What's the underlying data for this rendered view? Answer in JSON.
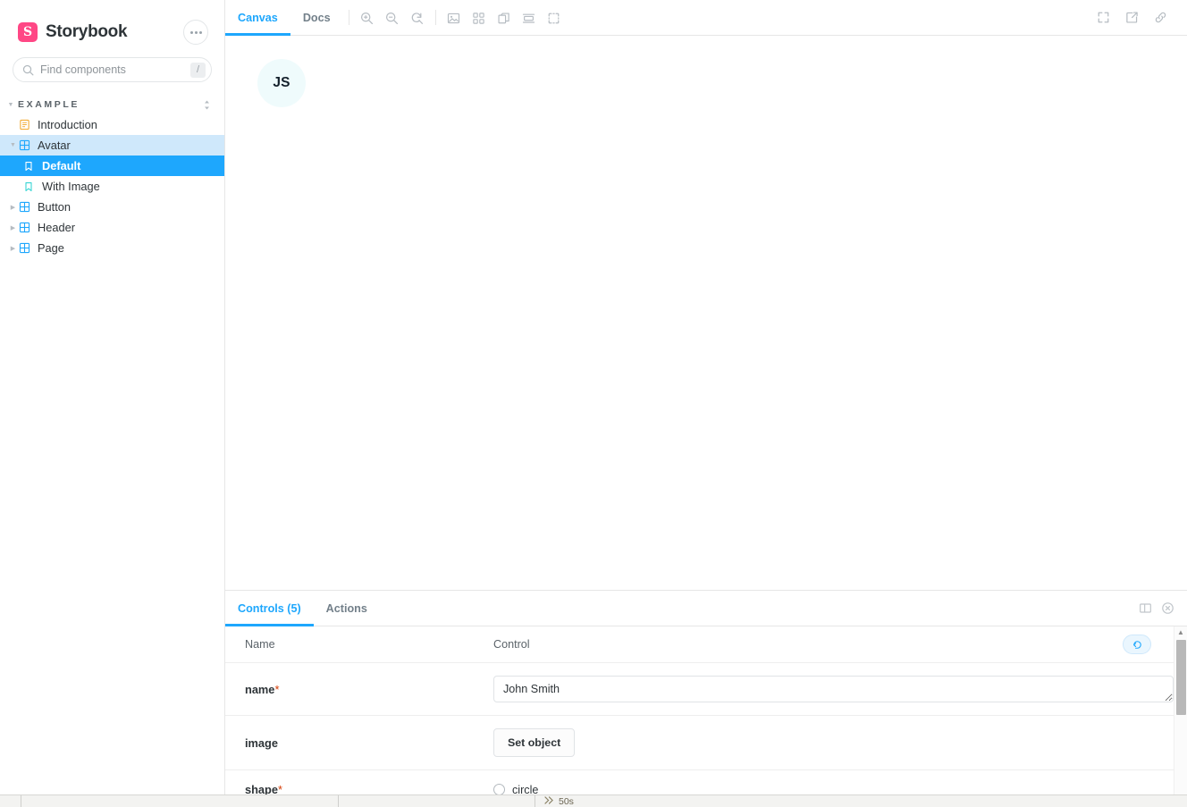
{
  "brand": {
    "name": "Storybook",
    "logo_letter": "S",
    "logo_color": "#ff4785",
    "menu_icon": "ellipsis-icon"
  },
  "search": {
    "placeholder": "Find components",
    "value": "",
    "shortcut": "/"
  },
  "sidebar": {
    "section": {
      "label": "EXAMPLE"
    },
    "items": [
      {
        "label": "Introduction",
        "icon": "document-icon",
        "level": 1,
        "state": "normal"
      },
      {
        "label": "Avatar",
        "icon": "component-icon",
        "level": 1,
        "state": "parent-active"
      },
      {
        "label": "Default",
        "icon": "story-icon",
        "level": 2,
        "state": "selected"
      },
      {
        "label": "With Image",
        "icon": "story-icon",
        "level": 2,
        "state": "normal"
      },
      {
        "label": "Button",
        "icon": "component-icon",
        "level": 1,
        "state": "normal"
      },
      {
        "label": "Header",
        "icon": "component-icon",
        "level": 1,
        "state": "normal"
      },
      {
        "label": "Page",
        "icon": "component-icon",
        "level": 1,
        "state": "normal"
      }
    ]
  },
  "toolbar": {
    "tabs": [
      {
        "label": "Canvas",
        "active": true
      },
      {
        "label": "Docs",
        "active": false
      }
    ],
    "zoom_tools": [
      "zoom-in-icon",
      "zoom-out-icon",
      "zoom-reset-icon"
    ],
    "view_tools": [
      "backgrounds-icon",
      "grid-icon",
      "measure-icon",
      "viewport-icon",
      "outline-icon"
    ],
    "right_tools": [
      "fullscreen-icon",
      "open-new-tab-icon",
      "copy-link-icon"
    ]
  },
  "canvas": {
    "avatar": {
      "initials": "JS",
      "background": "#effbfc",
      "text_color": "#13202b"
    }
  },
  "panel": {
    "tabs": [
      {
        "label": "Controls (5)",
        "active": true
      },
      {
        "label": "Actions",
        "active": false
      }
    ],
    "icons": [
      "panel-layout-icon",
      "close-panel-icon"
    ],
    "reset_icon": "reset-controls-icon",
    "columns": {
      "name": "Name",
      "control": "Control"
    },
    "rows": [
      {
        "name": "name",
        "required": true,
        "control_type": "textarea",
        "value": "John Smith"
      },
      {
        "name": "image",
        "required": false,
        "control_type": "button",
        "button_label": "Set object"
      },
      {
        "name": "shape",
        "required": true,
        "control_type": "radio",
        "option_label": "circle",
        "checked": false
      }
    ],
    "required_marker": "*"
  },
  "bottombar": {
    "timer": "50s",
    "timer_icon": "fast-forward-icon"
  }
}
